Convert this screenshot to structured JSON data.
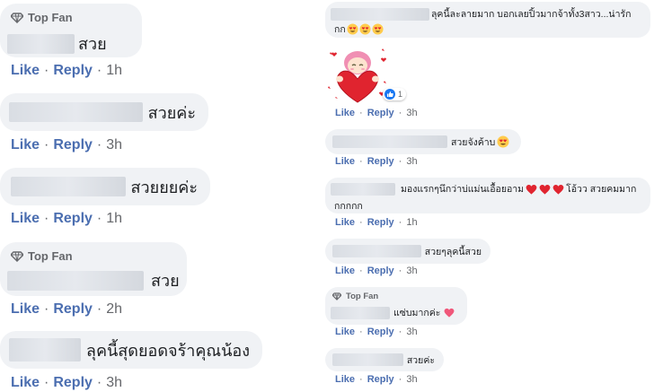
{
  "common": {
    "like": "Like",
    "reply": "Reply",
    "dot": "·",
    "top_fan": "Top Fan"
  },
  "left": [
    {
      "text": "สวย",
      "time": "1h",
      "top_fan": true
    },
    {
      "text": "สวยค่ะ",
      "time": "3h",
      "top_fan": false
    },
    {
      "text": "สวยยยค่ะ",
      "time": "1h",
      "top_fan": false
    },
    {
      "text": "สวย",
      "time": "2h",
      "top_fan": true
    },
    {
      "text": "ลุคนี้สุดยอดจร้าคุณน้อง",
      "time": "3h",
      "top_fan": false
    }
  ],
  "right": [
    {
      "line1": "ลุคนี้ละลายมาก บอกเลยปิ้วมากจ้าทั้ง3สาว...น่ารัก",
      "line2": "กก",
      "emoji_count": 3,
      "time": "3h"
    },
    {
      "sticker": "heart-girl-sticker",
      "reaction_count": "1",
      "time": "3h"
    },
    {
      "text": "สวยจังค้าบ",
      "emoji_count": 1,
      "time": "3h"
    },
    {
      "line1": "มองแรกๆนึกว่าบ่แม่นเอื้อยอาม",
      "line1b": "โอ้วว สวยคมมาก",
      "line2": "กกกกก",
      "hearts": 3,
      "time": "1h"
    },
    {
      "text": "สวยๆลุคนี้สวย",
      "time": "3h"
    },
    {
      "text": "แซ่บมากค่ะ",
      "top_fan": true,
      "time": "3h"
    },
    {
      "text": "สวยค่ะ",
      "time": "3h"
    }
  ],
  "colors": {
    "link": "#4b6eb0",
    "bubble": "#f0f2f5",
    "meta": "#65676b",
    "heart": "#e0242f"
  }
}
